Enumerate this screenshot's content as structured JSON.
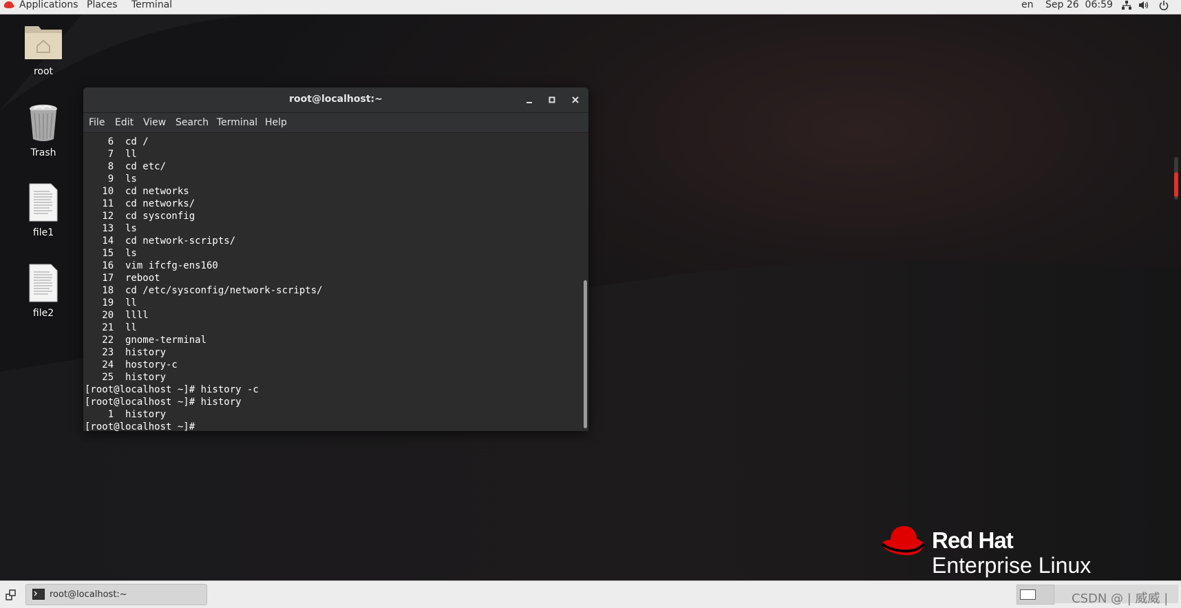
{
  "topbar": {
    "applications": "Applications",
    "places": "Places",
    "terminal": "Terminal",
    "lang": "en",
    "datetime": "Sep 26  06:59",
    "icons": [
      "redhat-hat-icon",
      "network-icon",
      "volume-icon",
      "power-icon"
    ]
  },
  "desktop": {
    "icons": [
      {
        "label": "root",
        "icon": "home-folder-icon"
      },
      {
        "label": "Trash",
        "icon": "trash-icon"
      },
      {
        "label": "file1",
        "icon": "text-file-icon"
      },
      {
        "label": "file2",
        "icon": "text-file-icon"
      }
    ]
  },
  "terminal": {
    "title": "root@localhost:~",
    "menu": [
      "File",
      "Edit",
      "View",
      "Search",
      "Terminal",
      "Help"
    ],
    "lines": [
      "    6  cd /",
      "    7  ll",
      "    8  cd etc/",
      "    9  ls",
      "   10  cd networks",
      "   11  cd networks/",
      "   12  cd sysconfig",
      "   13  ls",
      "   14  cd network-scripts/",
      "   15  ls",
      "   16  vim ifcfg-ens160",
      "   17  reboot",
      "   18  cd /etc/sysconfig/network-scripts/",
      "   19  ll",
      "   20  llll",
      "   21  ll",
      "   22  gnome-terminal",
      "   23  history",
      "   24  hostory-c",
      "   25  history",
      "[root@localhost ~]# history -c",
      "[root@localhost ~]# history",
      "    1  history",
      "[root@localhost ~]# "
    ]
  },
  "branding": {
    "name": "Red Hat",
    "product": "Enterprise Linux",
    "brand_color": "#ee0000"
  },
  "taskbar": {
    "window_label": "root@localhost:~",
    "watermark": "CSDN @ | 威威 |"
  },
  "colors": {
    "topbar_bg": "#ededed",
    "terminal_bg": "#2c2c2c",
    "accent_red": "#e0312b"
  }
}
